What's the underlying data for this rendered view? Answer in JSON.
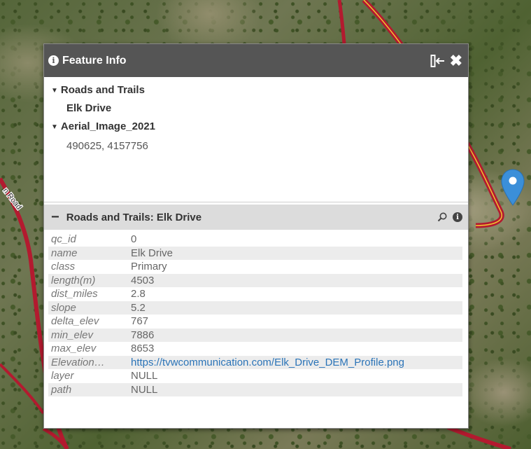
{
  "popup": {
    "title": "Feature Info",
    "tree": [
      {
        "group": "Roads and Trails",
        "item": "Elk Drive"
      },
      {
        "group": "Aerial_Image_2021",
        "item": "490625, 4157756"
      }
    ]
  },
  "map": {
    "road_label": "n Road"
  },
  "section": {
    "title": "Roads and Trails: Elk Drive",
    "rows": [
      {
        "key": "qc_id",
        "value": "0"
      },
      {
        "key": "name",
        "value": "Elk Drive"
      },
      {
        "key": "class",
        "value": "Primary"
      },
      {
        "key": "length(m)",
        "value": "4503"
      },
      {
        "key": "dist_miles",
        "value": "2.8"
      },
      {
        "key": "slope",
        "value": "5.2"
      },
      {
        "key": "delta_elev",
        "value": "767"
      },
      {
        "key": "min_elev",
        "value": "7886"
      },
      {
        "key": "max_elev",
        "value": "8653"
      },
      {
        "key": "Elevation…",
        "value": "https://tvwcommunication.com/Elk_Drive_DEM_Profile.png",
        "link": true
      },
      {
        "key": "layer",
        "value": "NULL"
      },
      {
        "key": "path",
        "value": "NULL"
      }
    ]
  },
  "colors": {
    "titlebar": "#555555",
    "road": "#d21f3c",
    "road_center": "#f2c230",
    "pin": "#3b8fd9",
    "link": "#2b74b8"
  }
}
